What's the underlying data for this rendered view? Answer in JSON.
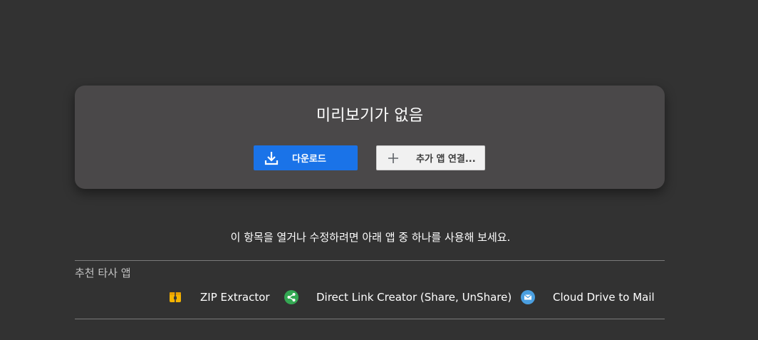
{
  "preview": {
    "title": "미리보기가 없음",
    "download_label": "다운로드",
    "connect_label": "추가 앱 연결...",
    "download_icon": "download-icon",
    "connect_icon": "plus-icon"
  },
  "hint_text": "이 항목을 열거나 수정하려면 아래 앱 중 하나를 사용해 보세요.",
  "recommended": {
    "label": "추천 타사 앱",
    "apps": [
      {
        "name": "ZIP Extractor",
        "icon": "zip-icon"
      },
      {
        "name": "Direct Link Creator (Share, UnShare)",
        "icon": "share-icon"
      },
      {
        "name": "Cloud Drive to Mail",
        "icon": "mail-icon"
      }
    ]
  },
  "colors": {
    "background": "#323232",
    "card": "#4a4849",
    "primary_button": "#1a73e8",
    "secondary_button": "#f1f1f1"
  }
}
